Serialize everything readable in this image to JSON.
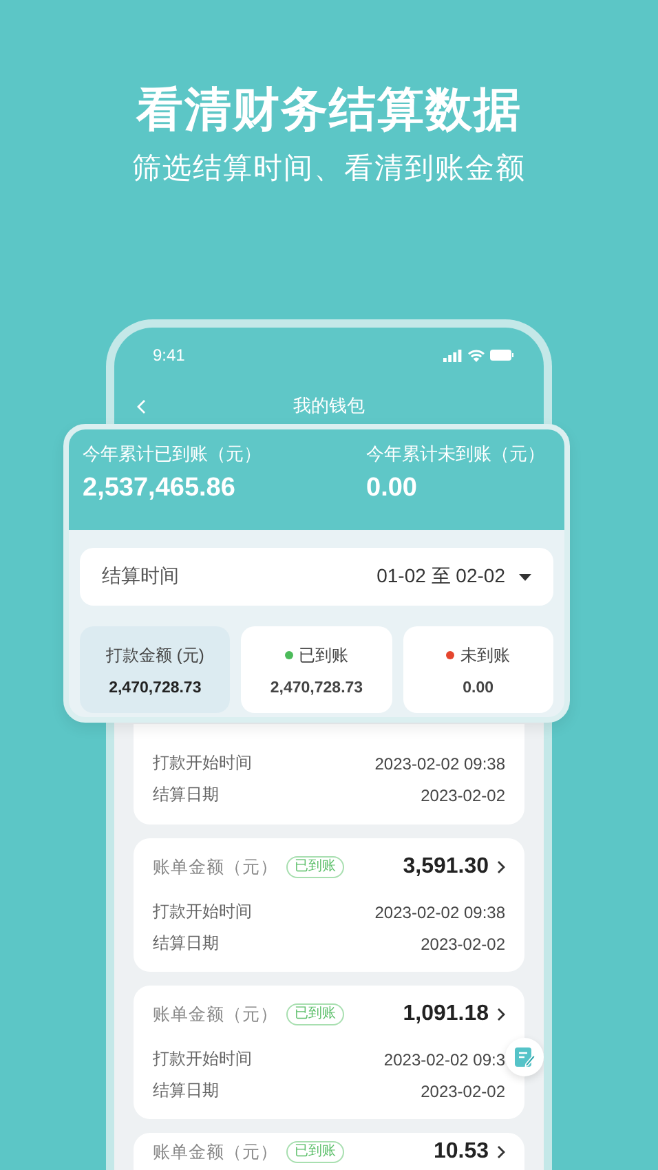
{
  "headline": "看清财务结算数据",
  "subheadline": "筛选结算时间、看清到账金额",
  "phone": {
    "status_bar": {
      "time": "9:41"
    },
    "nav": {
      "title": "我的钱包"
    }
  },
  "summary": {
    "totals": [
      {
        "label": "今年累计已到账（元）",
        "value": "2,537,465.86"
      },
      {
        "label": "今年累计未到账（元）",
        "value": "0.00"
      }
    ],
    "filter": {
      "label": "结算时间",
      "value": "01-02 至 02-02"
    },
    "tiles": [
      {
        "label": "打款金额 (元)",
        "value": "2,470,728.73",
        "selected": true
      },
      {
        "label": "已到账",
        "value": "2,470,728.73",
        "selected": false,
        "color": "#4cbb5a"
      },
      {
        "label": "未到账",
        "value": "0.00",
        "selected": false,
        "color": "#e5462e"
      }
    ]
  },
  "bills": [
    {
      "rows": [
        {
          "label": "打款开始时间",
          "value": "2023-02-02 09:38"
        },
        {
          "label": "结算日期",
          "value": "2023-02-02"
        }
      ]
    },
    {
      "label": "账单金额（元）",
      "status": "已到账",
      "amount": "3,591.30",
      "rows": [
        {
          "label": "打款开始时间",
          "value": "2023-02-02 09:38"
        },
        {
          "label": "结算日期",
          "value": "2023-02-02"
        }
      ]
    },
    {
      "label": "账单金额（元）",
      "status": "已到账",
      "amount": "1,091.18",
      "rows": [
        {
          "label": "打款开始时间",
          "value": "2023-02-02 09:3"
        },
        {
          "label": "结算日期",
          "value": "2023-02-02"
        }
      ]
    },
    {
      "label": "账单金额（元）",
      "status": "已到账",
      "amount": "10.53"
    }
  ]
}
